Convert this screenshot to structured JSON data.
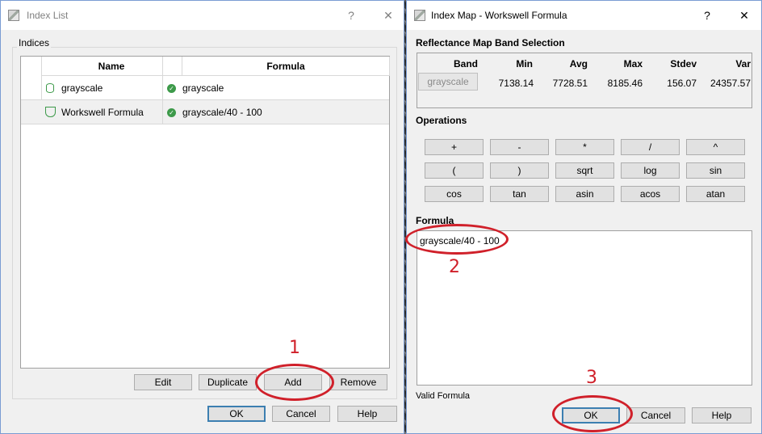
{
  "left_dialog": {
    "title": "Index List",
    "help": "?",
    "close": "✕",
    "group_label": "Indices",
    "columns": [
      "Name",
      "Formula"
    ],
    "rows": [
      {
        "name": "grayscale",
        "formula": "grayscale",
        "selected": false
      },
      {
        "name": "Workswell Formula",
        "formula": "grayscale/40 - 100",
        "selected": true
      }
    ],
    "buttons": {
      "edit": "Edit",
      "duplicate": "Duplicate",
      "add": "Add",
      "remove": "Remove"
    },
    "footer": {
      "ok": "OK",
      "cancel": "Cancel",
      "help": "Help"
    }
  },
  "right_dialog": {
    "title": "Index Map - Workswell Formula",
    "help": "?",
    "close": "✕",
    "band_section": {
      "title": "Reflectance Map Band Selection",
      "headers": [
        "Band",
        "Min",
        "Avg",
        "Max",
        "Stdev",
        "Var"
      ],
      "band_button": "grayscale",
      "values": [
        "7138.14",
        "7728.51",
        "8185.46",
        "156.07",
        "24357.57"
      ]
    },
    "operations": {
      "title": "Operations",
      "rows": [
        [
          "+",
          "-",
          "*",
          "/",
          "^"
        ],
        [
          "(",
          ")",
          "sqrt",
          "log",
          "sin"
        ],
        [
          "cos",
          "tan",
          "asin",
          "acos",
          "atan"
        ]
      ]
    },
    "formula": {
      "title": "Formula",
      "value": "grayscale/40 - 100",
      "status": "Valid Formula"
    },
    "footer": {
      "ok": "OK",
      "cancel": "Cancel",
      "help": "Help"
    }
  },
  "annotations": [
    "1",
    "2",
    "3"
  ],
  "colors": {
    "annotation": "#d0202a",
    "accent": "#3c7fb1",
    "status_ok": "#3d9a4a"
  }
}
